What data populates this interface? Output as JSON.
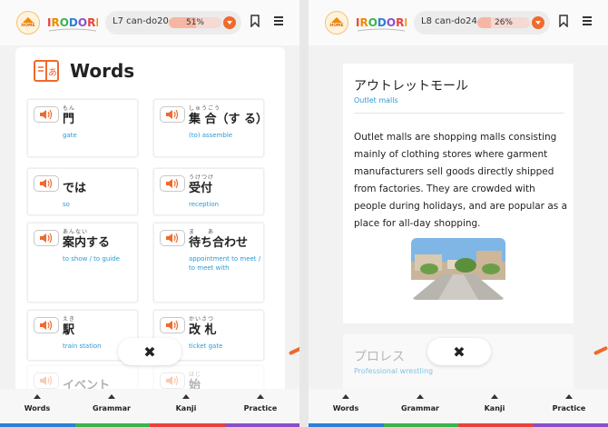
{
  "left": {
    "header": {
      "home_label": "HOME",
      "logo_text": "IRODORI",
      "level": "L7 can-do20",
      "progress_pct": 51,
      "progress_text": "51%"
    },
    "section": {
      "title": "Words"
    },
    "words": [
      {
        "furigana": "もん",
        "jp": "門",
        "en": "gate"
      },
      {
        "furigana": "しゅうごう",
        "jp": "集 合（す る）",
        "en": "(to) assemble"
      },
      {
        "furigana": "",
        "jp": "では",
        "en": "so"
      },
      {
        "furigana": "うけつけ",
        "jp": "受付",
        "en": "reception"
      },
      {
        "furigana": "あんない",
        "jp": "案内する",
        "en": "to show / to guide"
      },
      {
        "furigana": "ま　　あ",
        "jp": "待ち合わせ",
        "en": "appointment to meet / to meet with"
      },
      {
        "furigana": "えき",
        "jp": "駅",
        "en": "train station"
      },
      {
        "furigana": "かいさつ",
        "jp": "改 札",
        "en": "ticket gate"
      },
      {
        "furigana": "",
        "jp": "イベント",
        "en": ""
      },
      {
        "furigana": "はじ",
        "jp": "始",
        "en": ""
      }
    ],
    "close": "✖"
  },
  "right": {
    "header": {
      "home_label": "HOME",
      "logo_text": "IRODORI",
      "level": "L8 can-do24",
      "progress_pct": 26,
      "progress_text": "26%"
    },
    "article": {
      "title": "アウトレットモール",
      "subtitle": "Outlet malls",
      "body": "Outlet malls are shopping malls consisting mainly of clothing stores where garment manufacturers sell goods directly shipped from factories. They are crowded with people during holidays, and are popular as a place for all-day shopping."
    },
    "next_article": {
      "title": "プロレス",
      "subtitle": "Professional wrestling"
    },
    "close": "✖"
  },
  "nav": [
    "Words",
    "Grammar",
    "Kanji",
    "Practice"
  ],
  "colors": {
    "accent": "#ef6a2c",
    "link": "#2a9bd6",
    "strip": [
      "#2e7fd8",
      "#3bb54a",
      "#e8433a",
      "#8a4fc8"
    ]
  }
}
